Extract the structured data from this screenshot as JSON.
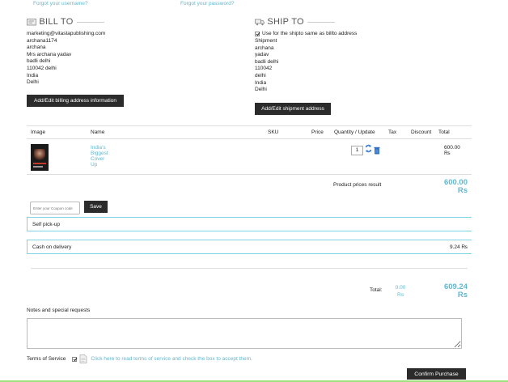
{
  "top_links": {
    "forgot_username": "Forgot your username?",
    "forgot_password": "Forgot your password?"
  },
  "bill_to": {
    "title": "BILL TO",
    "lines": [
      "marketing@vitastapublishing.com",
      "archana1174",
      "archana",
      "Mrs archana  yadav",
      "badli delhi",
      "110042 delhi",
      "India",
      "Delhi"
    ],
    "button": "Add/Edit billing address information"
  },
  "ship_to": {
    "title": "SHIP TO",
    "same_as_billto": "Use for the shipto same as billto address",
    "lines": [
      "Shipment",
      "archana",
      "yadav",
      "badli delhi",
      "110042",
      "delhi",
      "India",
      "Delhi"
    ],
    "button": "Add/Edit shipment address"
  },
  "table": {
    "headers": {
      "image": "Image",
      "name": "Name",
      "sku": "SKU",
      "price": "Price",
      "qty": "Quantity / Update",
      "tax": "Tax",
      "discount": "Discount",
      "total": "Total"
    },
    "rows": [
      {
        "name": "India's Biggest Cover Up",
        "qty": "1",
        "total": "600.00 ₨"
      }
    ]
  },
  "product_result": {
    "label": "Product prices result",
    "total_line1": "600.00",
    "total_line2": "Rs"
  },
  "coupon": {
    "placeholder": "Enter your Coupon code",
    "save": "Save"
  },
  "shipping": {
    "option": "Self pick-up"
  },
  "payment": {
    "option": "Cash on delivery",
    "price": "9.24 ₨"
  },
  "grand_total": {
    "label": "Total:",
    "tax_line1": "0.00",
    "tax_line2": "Rs",
    "total_line1": "609.24",
    "total_line2": "Rs"
  },
  "notes": {
    "label": "Notes and special requests"
  },
  "tos": {
    "label": "Terms of Service",
    "link": "Click here to read terms of service and check the box to accept them."
  },
  "confirm": {
    "label": "Confirm Purchase"
  }
}
